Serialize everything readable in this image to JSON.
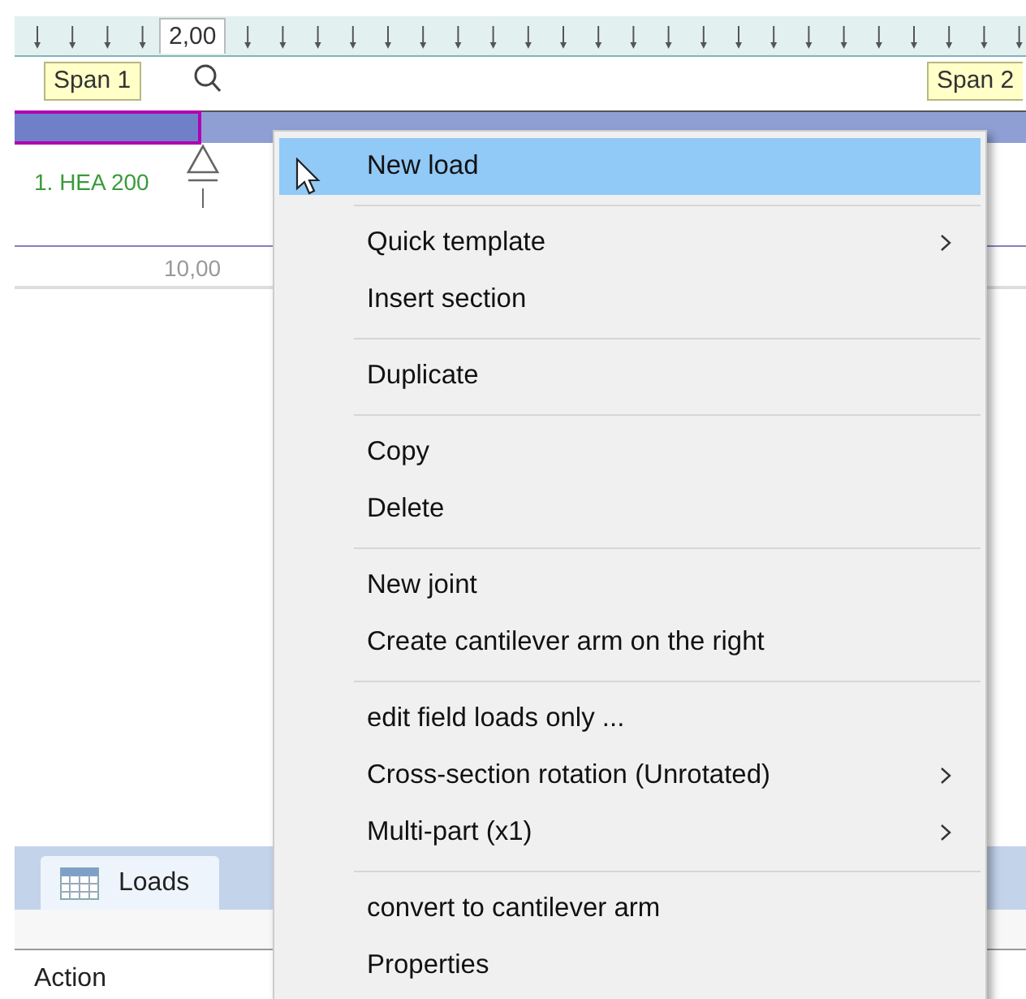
{
  "ruler": {
    "value_label": "2,00"
  },
  "spans": [
    {
      "label": "Span 1"
    },
    {
      "label": "Span 2"
    }
  ],
  "beam": {
    "section_label": "1. HEA 200",
    "dimension": "10,00"
  },
  "context_menu": {
    "items": [
      {
        "kind": "item",
        "label": "New load",
        "selected": true,
        "submenu": false
      },
      {
        "kind": "separator"
      },
      {
        "kind": "item",
        "label": "Quick template",
        "selected": false,
        "submenu": true
      },
      {
        "kind": "item",
        "label": "Insert section",
        "selected": false,
        "submenu": false
      },
      {
        "kind": "separator"
      },
      {
        "kind": "item",
        "label": "Duplicate",
        "selected": false,
        "submenu": false
      },
      {
        "kind": "separator"
      },
      {
        "kind": "item",
        "label": "Copy",
        "selected": false,
        "submenu": false
      },
      {
        "kind": "item",
        "label": "Delete",
        "selected": false,
        "submenu": false
      },
      {
        "kind": "separator"
      },
      {
        "kind": "item",
        "label": "New joint",
        "selected": false,
        "submenu": false
      },
      {
        "kind": "item",
        "label": "Create cantilever arm on the right",
        "selected": false,
        "submenu": false
      },
      {
        "kind": "separator"
      },
      {
        "kind": "item",
        "label": "edit field loads only ...",
        "selected": false,
        "submenu": false
      },
      {
        "kind": "item",
        "label": "Cross-section rotation (Unrotated)",
        "selected": false,
        "submenu": true
      },
      {
        "kind": "item",
        "label": "Multi-part (x1)",
        "selected": false,
        "submenu": true
      },
      {
        "kind": "separator"
      },
      {
        "kind": "item",
        "label": "convert to cantilever arm",
        "selected": false,
        "submenu": false
      },
      {
        "kind": "item",
        "label": "Properties",
        "selected": false,
        "submenu": false
      }
    ]
  },
  "bottom_panel": {
    "tabs": [
      {
        "label": "Loads",
        "selected": true
      }
    ],
    "table": {
      "columns": [
        "Action"
      ]
    }
  }
}
